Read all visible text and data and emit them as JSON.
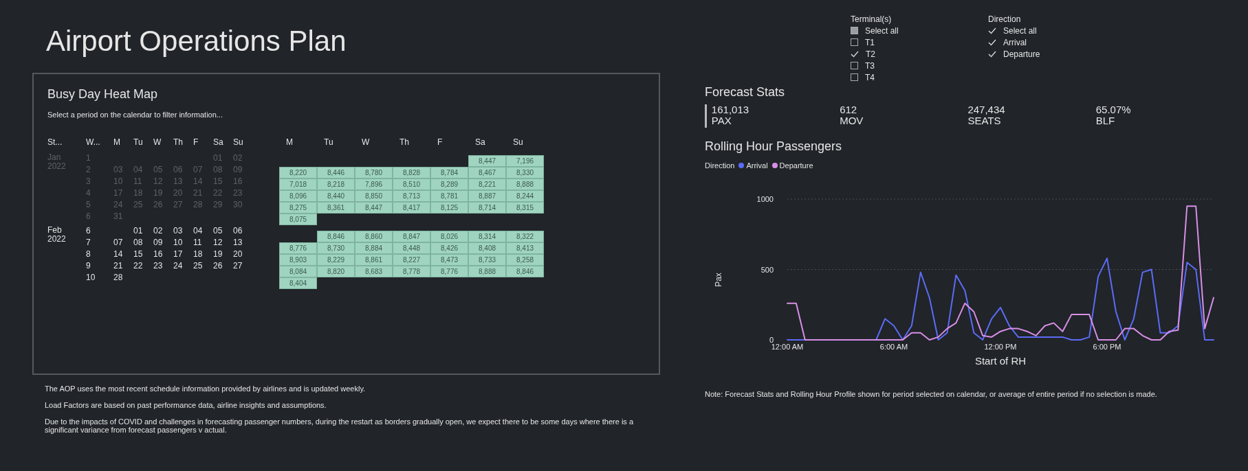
{
  "title": "Airport Operations Plan",
  "heat_map_panel": {
    "title": "Busy Day Heat Map",
    "subtitle": "Select a period on the calendar to filter information...",
    "calendar": {
      "columns": [
        "St...",
        "W...",
        "M",
        "Tu",
        "W",
        "Th",
        "F",
        "Sa",
        "Su"
      ],
      "months": [
        {
          "label": "Jan 2022",
          "disabled": true,
          "weeks": [
            {
              "week": "1",
              "days": [
                "01",
                "02"
              ]
            },
            {
              "week": "2",
              "days": [
                "03",
                "04",
                "05",
                "06",
                "07",
                "08",
                "09"
              ]
            },
            {
              "week": "3",
              "days": [
                "10",
                "11",
                "12",
                "13",
                "14",
                "15",
                "16"
              ]
            },
            {
              "week": "4",
              "days": [
                "17",
                "18",
                "19",
                "20",
                "21",
                "22",
                "23"
              ]
            },
            {
              "week": "5",
              "days": [
                "24",
                "25",
                "26",
                "27",
                "28",
                "29",
                "30"
              ]
            },
            {
              "week": "6",
              "days": [
                "31"
              ]
            }
          ]
        },
        {
          "label": "Feb 2022",
          "disabled": false,
          "weeks": [
            {
              "week": "6",
              "days": [
                "01",
                "02",
                "03",
                "04",
                "05",
                "06"
              ]
            },
            {
              "week": "7",
              "days": [
                "07",
                "08",
                "09",
                "10",
                "11",
                "12",
                "13"
              ]
            },
            {
              "week": "8",
              "days": [
                "14",
                "15",
                "16",
                "17",
                "18",
                "19",
                "20"
              ]
            },
            {
              "week": "9",
              "days": [
                "21",
                "22",
                "23",
                "24",
                "25",
                "26",
                "27"
              ]
            },
            {
              "week": "10",
              "days": [
                "28"
              ]
            }
          ]
        }
      ]
    },
    "heat_map": {
      "columns": [
        "M",
        "Tu",
        "W",
        "Th",
        "F",
        "Sa",
        "Su"
      ],
      "months": [
        {
          "weeks": [
            [
              "8,447",
              "7,196"
            ],
            [
              "8,220",
              "8,446",
              "8,780",
              "8,828",
              "8,784",
              "8,467",
              "8,330"
            ],
            [
              "7,018",
              "8,218",
              "7,896",
              "8,510",
              "8,289",
              "8,221",
              "8,888"
            ],
            [
              "8,096",
              "8,440",
              "8,850",
              "8,713",
              "8,781",
              "8,887",
              "8,244"
            ],
            [
              "8,275",
              "8,361",
              "8,447",
              "8,417",
              "8,125",
              "8,714",
              "8,315"
            ],
            [
              "8,075"
            ]
          ]
        },
        {
          "weeks": [
            [
              "8,846",
              "8,860",
              "8,847",
              "8,026",
              "8,314",
              "8,322"
            ],
            [
              "8,776",
              "8,730",
              "8,884",
              "8,448",
              "8,426",
              "8,408",
              "8,413"
            ],
            [
              "8,903",
              "8,229",
              "8,861",
              "8,227",
              "8,473",
              "8,733",
              "8,258"
            ],
            [
              "8,084",
              "8,820",
              "8,683",
              "8,778",
              "8,776",
              "8,888",
              "8,846"
            ],
            [
              "8,404"
            ]
          ]
        }
      ]
    }
  },
  "filters": [
    {
      "title": "Terminal(s)",
      "options": [
        {
          "label": "Select all",
          "checked": false,
          "mixed": true
        },
        {
          "label": "T1",
          "checked": false,
          "mixed": false
        },
        {
          "label": "T2",
          "checked": true,
          "mixed": false
        },
        {
          "label": "T3",
          "checked": false,
          "mixed": false
        },
        {
          "label": "T4",
          "checked": false,
          "mixed": false
        }
      ]
    },
    {
      "title": "Direction",
      "options": [
        {
          "label": "Select all",
          "checked": true,
          "mixed": false
        },
        {
          "label": "Arrival",
          "checked": true,
          "mixed": false
        },
        {
          "label": "Departure",
          "checked": true,
          "mixed": false
        }
      ]
    }
  ],
  "forecast_stats": {
    "title": "Forecast Stats",
    "stats": [
      {
        "value": "161,013",
        "label": "PAX"
      },
      {
        "value": "612",
        "label": "MOV"
      },
      {
        "value": "247,434",
        "label": "SEATS"
      },
      {
        "value": "65.07%",
        "label": "BLF"
      }
    ]
  },
  "rolling_hour": {
    "title": "Rolling Hour Passengers",
    "legend_title": "Direction",
    "chart_data": {
      "type": "line",
      "xlabel": "Start of RH",
      "ylabel": "Pax",
      "x": [
        0,
        0.5,
        1,
        1.5,
        2,
        2.5,
        3,
        3.5,
        4,
        4.5,
        5,
        5.5,
        6,
        6.5,
        7,
        7.5,
        8,
        8.5,
        9,
        9.5,
        10,
        10.5,
        11,
        11.5,
        12,
        12.5,
        13,
        13.5,
        14,
        14.5,
        15,
        15.5,
        16,
        16.5,
        17,
        17.5,
        18,
        18.5,
        19,
        19.5,
        20,
        20.5,
        21,
        21.5,
        22,
        22.5,
        23,
        23.5,
        24
      ],
      "xlim": [
        0,
        24
      ],
      "ylim": [
        0,
        1000
      ],
      "xticks": [
        {
          "value": 0,
          "label": "12:00 AM"
        },
        {
          "value": 6,
          "label": "6:00 AM"
        },
        {
          "value": 12,
          "label": "12:00 PM"
        },
        {
          "value": 18,
          "label": "6:00 PM"
        }
      ],
      "yticks": [
        0,
        500,
        1000
      ],
      "series": [
        {
          "name": "Arrival",
          "color": "#5b6cf5",
          "values": [
            0,
            0,
            0,
            0,
            0,
            0,
            0,
            0,
            0,
            0,
            0,
            150,
            100,
            0,
            100,
            480,
            300,
            0,
            50,
            460,
            350,
            50,
            0,
            150,
            230,
            100,
            20,
            20,
            20,
            20,
            20,
            20,
            0,
            0,
            20,
            450,
            580,
            200,
            0,
            150,
            480,
            500,
            50,
            50,
            100,
            550,
            500,
            0,
            0
          ]
        },
        {
          "name": "Departure",
          "color": "#d88fe6",
          "values": [
            260,
            260,
            0,
            0,
            0,
            0,
            0,
            0,
            0,
            0,
            0,
            0,
            0,
            0,
            50,
            50,
            0,
            20,
            80,
            120,
            260,
            200,
            30,
            20,
            60,
            80,
            80,
            60,
            30,
            100,
            120,
            60,
            180,
            180,
            180,
            0,
            0,
            0,
            80,
            80,
            30,
            0,
            0,
            60,
            70,
            950,
            950,
            80,
            300
          ]
        }
      ]
    }
  },
  "notes": [
    "The AOP uses the most recent schedule information provided by airlines and is updated weekly.",
    "Load Factors are based on past performance data, airline insights and assumptions.",
    "Due to the impacts of COVID and challenges in forecasting passenger numbers, during the restart as borders gradually open, we expect there to be some days where there is a significant variance from forecast passengers v actual."
  ],
  "side_note": "Note: Forecast Stats and Rolling Hour Profile shown for period selected on calendar, or average of entire period if no selection is made."
}
